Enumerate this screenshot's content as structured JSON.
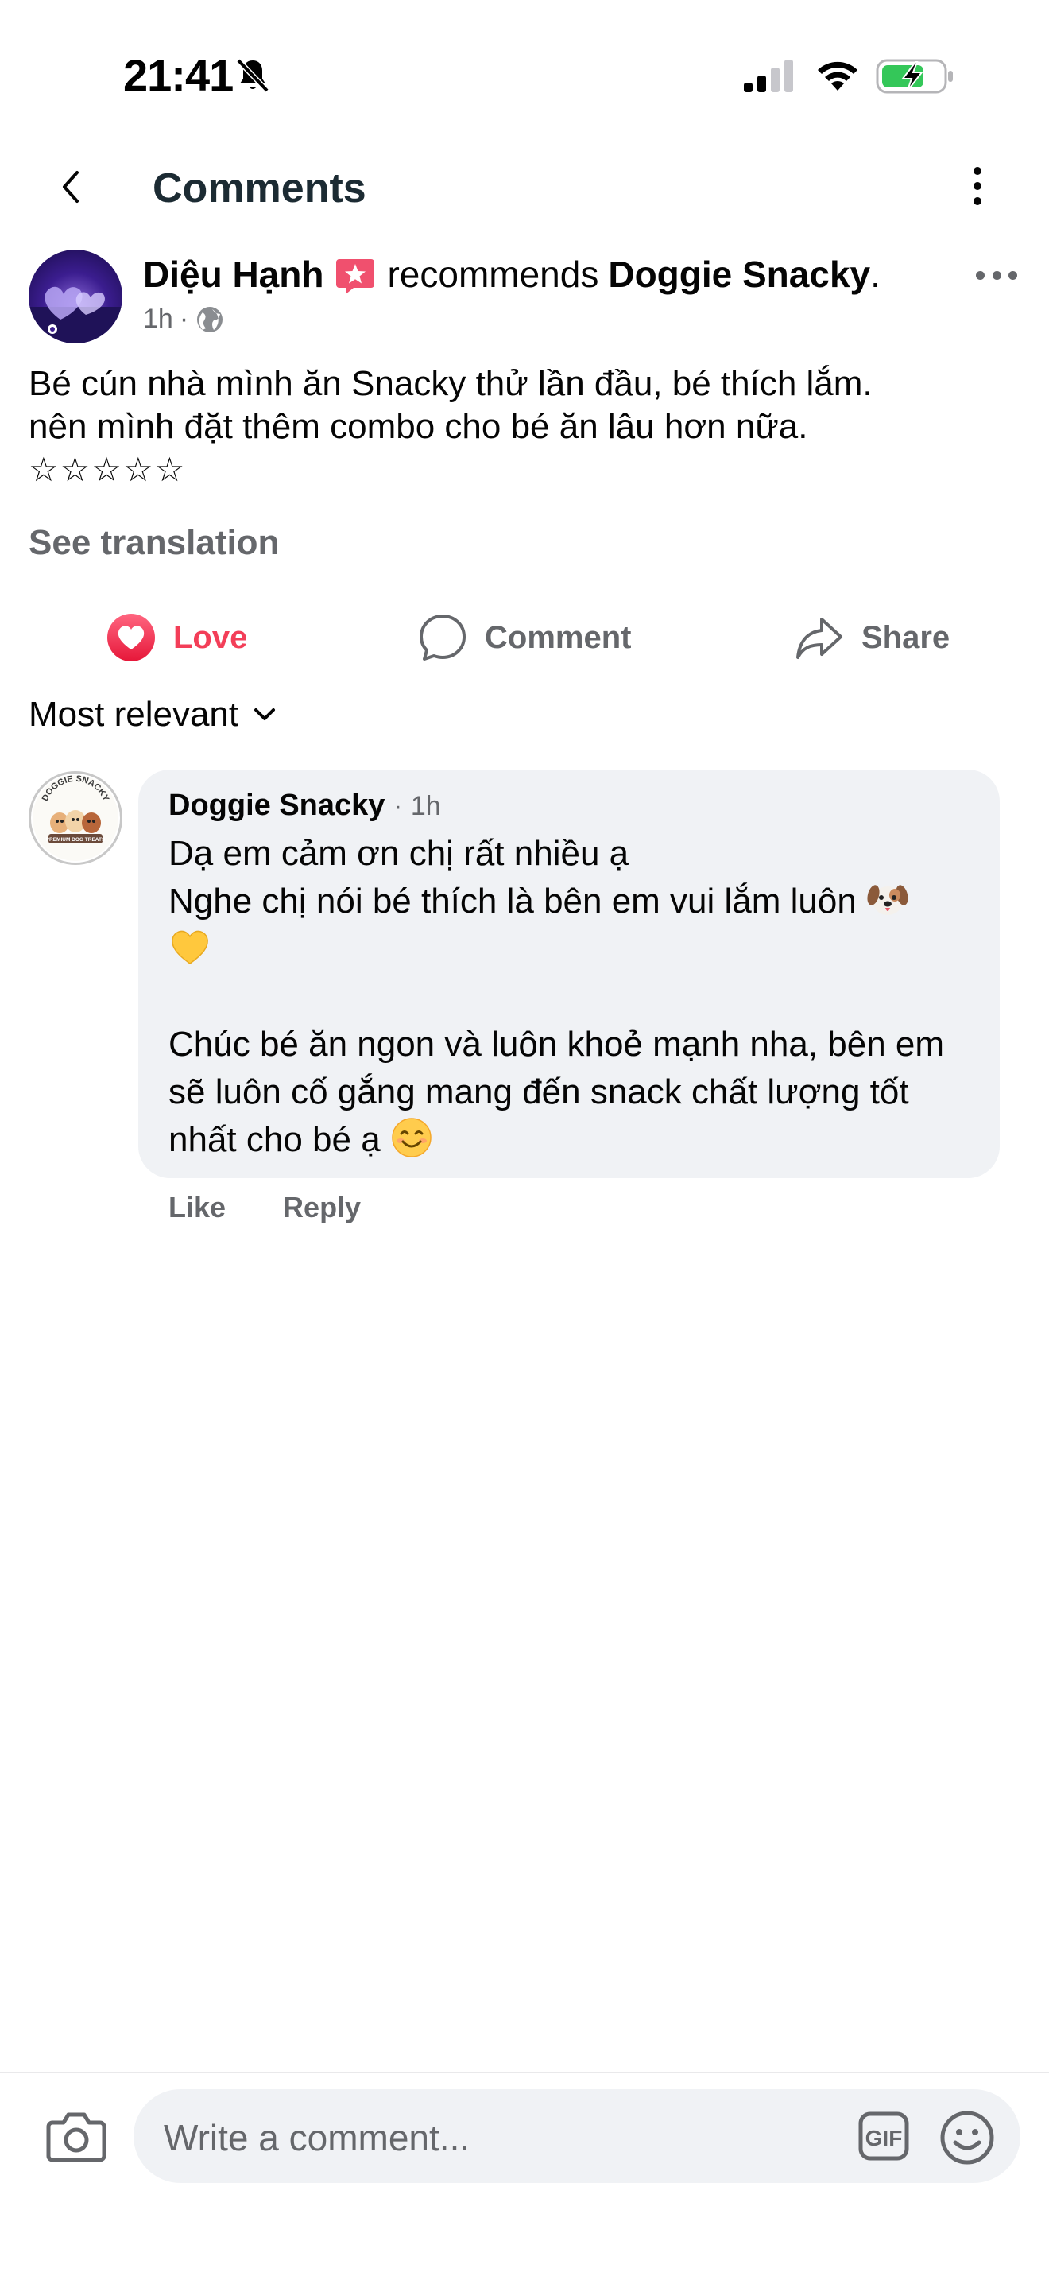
{
  "status_bar": {
    "time": "21:41",
    "icons": [
      "bell-slash-icon",
      "cellular-signal-icon",
      "wifi-icon",
      "battery-charging-icon"
    ]
  },
  "header": {
    "title": "Comments",
    "back_icon": "chevron-left-icon",
    "menu_icon": "vertical-ellipsis-icon"
  },
  "post": {
    "author": "Diệu Hạnh",
    "recommends_text": "recommends",
    "page": "Doggie Snacky",
    "page_suffix": ".",
    "time": "1h",
    "separator": "·",
    "privacy_icon": "globe-icon",
    "text_lines": [
      "Bé cún nhà mình ăn Snacky thử lần đầu, bé thích lắm.",
      "nên mình đặt thêm combo cho bé ăn lâu hơn nữa.",
      "☆☆☆☆☆"
    ],
    "see_translation": "See translation"
  },
  "actions": {
    "love": "Love",
    "comment": "Comment",
    "share": "Share"
  },
  "sort": {
    "label": "Most relevant"
  },
  "comment": {
    "author": "Doggie Snacky",
    "separator": "·",
    "time": "1h",
    "avatar_text": [
      "DOGGIE SNACKY",
      "PREMIUM DOG TREATS"
    ],
    "lines": [
      "Dạ em cảm ơn chị rất nhiều ạ",
      "Nghe chị nói bé thích là bên em vui lắm luôn",
      "",
      "",
      "Chúc bé ăn ngon và luôn khoẻ mạnh nha, bên em",
      "sẽ luôn cố gắng mang đến snack chất lượng tốt",
      "nhất cho bé ạ"
    ],
    "emojis": [
      "dog-face-emoji",
      "yellow-heart-emoji",
      "smiling-face-emoji"
    ],
    "like": "Like",
    "reply": "Reply"
  },
  "composer": {
    "placeholder": "Write a comment...",
    "gif_label": "GIF"
  },
  "colors": {
    "love": "#f33e58",
    "secondary_text": "#65676b",
    "bubble": "#f0f2f5",
    "battery_green": "#34c759"
  }
}
